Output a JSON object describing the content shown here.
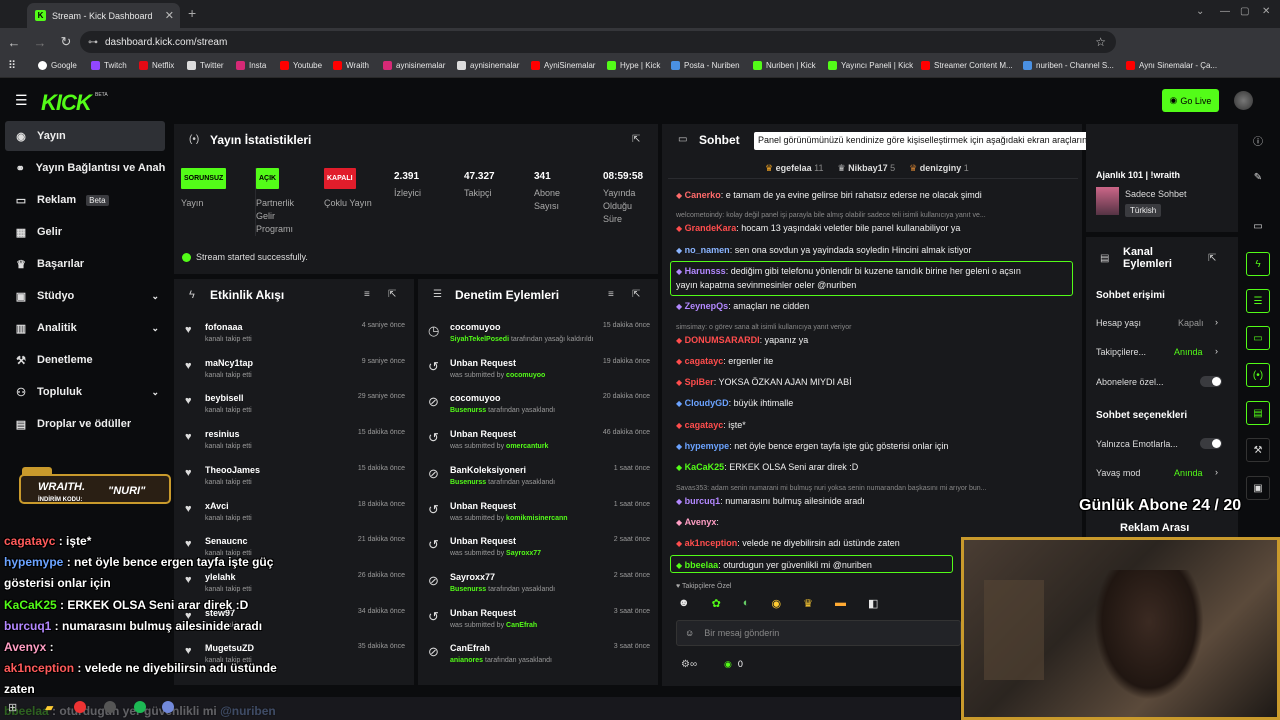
{
  "browser": {
    "tab_title": "Stream - Kick Dashboard",
    "url": "dashboard.kick.com/stream",
    "bookmarks": [
      "Google",
      "Twitch",
      "Netflix",
      "Twitter",
      "Insta",
      "Youtube",
      "Wraith",
      "aynisinemalar",
      "aynisinemalar",
      "AyniSinemalar",
      "Hype | Kick",
      "Posta - Nuriben",
      "Nuriben | Kick",
      "Yayıncı Paneli | Kick",
      "Streamer Content M...",
      "nuriben - Channel S...",
      "Aynı Sinemalar - Ça..."
    ]
  },
  "header": {
    "logo": "KICK",
    "logo_tag": "BETA",
    "go_live": "Go Live"
  },
  "sidebar": {
    "items": [
      {
        "label": "Yayın"
      },
      {
        "label": "Yayın Bağlantısı ve Anahtarı"
      },
      {
        "label": "Reklam",
        "tag": "Beta"
      },
      {
        "label": "Gelir"
      },
      {
        "label": "Başarılar"
      },
      {
        "label": "Stüdyo"
      },
      {
        "label": "Analitik"
      },
      {
        "label": "Denetleme"
      },
      {
        "label": "Topluluk"
      },
      {
        "label": "Droplar ve ödüller"
      }
    ]
  },
  "stats": {
    "title": "Yayın İstatistikleri",
    "items": [
      {
        "badge": "SORUNSUZ",
        "label": "Yayın"
      },
      {
        "badge": "AÇIK",
        "label": "Partnerlik Gelir Programı"
      },
      {
        "badge": "KAPALI",
        "label": "Çoklu Yayın"
      },
      {
        "value": "2.391",
        "label": "İzleyici"
      },
      {
        "value": "47.327",
        "label": "Takipçi"
      },
      {
        "value": "341",
        "label": "Abone Sayısı"
      },
      {
        "value": "08:59:58",
        "label": "Yayında Olduğu Süre"
      }
    ],
    "status": "Stream started successfully."
  },
  "activity": {
    "title": "Etkinlik Akışı",
    "rows": [
      {
        "name": "fofonaaa",
        "sub": "kanalı takip etti",
        "time": "4 saniye önce"
      },
      {
        "name": "maNcy1tap",
        "sub": "kanalı takip etti",
        "time": "9 saniye önce"
      },
      {
        "name": "beybisell",
        "sub": "kanalı takip etti",
        "time": "29 saniye önce"
      },
      {
        "name": "resinius",
        "sub": "kanalı takip etti",
        "time": "15 dakika önce"
      },
      {
        "name": "TheooJames",
        "sub": "kanalı takip etti",
        "time": "15 dakika önce"
      },
      {
        "name": "xAvci",
        "sub": "kanalı takip etti",
        "time": "18 dakika önce"
      },
      {
        "name": "Senaucnc",
        "sub": "kanalı takip etti",
        "time": "21 dakika önce"
      },
      {
        "name": "ylelahk",
        "sub": "kanalı takip etti",
        "time": "26 dakika önce"
      },
      {
        "name": "stew97",
        "sub": "kanalı takip etti",
        "time": "34 dakika önce"
      },
      {
        "name": "MugetsuZD",
        "sub": "kanalı takip etti",
        "time": "35 dakika önce"
      }
    ]
  },
  "moderation": {
    "title": "Denetim Eylemleri",
    "rows": [
      {
        "icon": "clock",
        "name": "cocomuyoo",
        "who": "SiyahTekelPosedi",
        "sub": "tarafından yasağı kaldırıldı",
        "time": "15 dakika önce"
      },
      {
        "icon": "undo",
        "name": "Unban Request",
        "sub": "was submitted by",
        "who": "cocomuyoo",
        "time": "19 dakika önce"
      },
      {
        "icon": "ban",
        "name": "cocomuyoo",
        "who": "Busenurss",
        "sub": "tarafından yasaklandı",
        "time": "20 dakika önce"
      },
      {
        "icon": "undo",
        "name": "Unban Request",
        "sub": "was submitted by",
        "who": "omercanturk",
        "time": "46 dakika önce"
      },
      {
        "icon": "ban",
        "name": "BanKoleksiyoneri",
        "who": "Busenurss",
        "sub": "tarafından yasaklandı",
        "time": "1 saat önce"
      },
      {
        "icon": "undo",
        "name": "Unban Request",
        "sub": "was submitted by",
        "who": "komikmisinercann",
        "time": "1 saat önce"
      },
      {
        "icon": "undo",
        "name": "Unban Request",
        "sub": "was submitted by",
        "who": "Sayroxx77",
        "time": "2 saat önce"
      },
      {
        "icon": "ban",
        "name": "Sayroxx77",
        "who": "Busenurss",
        "sub": "tarafından yasaklandı",
        "time": "2 saat önce"
      },
      {
        "icon": "undo",
        "name": "Unban Request",
        "sub": "was submitted by",
        "who": "CanEfrah",
        "time": "3 saat önce"
      },
      {
        "icon": "ban",
        "name": "CanEfrah",
        "who": "anianores",
        "sub": "tarafından yasaklandı",
        "time": "3 saat önce"
      }
    ]
  },
  "chat": {
    "title": "Sohbet",
    "tooltip": "Panel görünümünüzü kendinize göre kişiselleştirmek için aşağıdaki ekran araçlarına tıklayın veya sürükleyin",
    "top_gifters": [
      {
        "name": "egefelaa",
        "count": "11",
        "color": "#f5a623"
      },
      {
        "name": "Nikbay17",
        "count": "5",
        "color": "#cccccc"
      },
      {
        "name": "denizginy",
        "count": "1",
        "color": "#cd7f32"
      }
    ],
    "messages": [
      {
        "user": "Canerko",
        "color": "#ff6b6b",
        "text": ": e tamam de ya evine gelirse biri rahatsız ederse ne olacak şimdi"
      },
      {
        "system": "welcometoindy: kolay değil panel işi parayla bile almış olabilir sadece teli isimli kullanıcıya yanıt ve..."
      },
      {
        "user": "GrandeKara",
        "color": "#ff4d4d",
        "text": ": hocam 13 yaşındaki veletler bile panel kullanabiliyor ya"
      },
      {
        "user": "no_namen",
        "color": "#8ab4ff",
        "text": ": sen ona sovdun ya yayindada soyledin Hincini almak istiyor"
      },
      {
        "user": "Harunsss",
        "color": "#b388ff",
        "text": ": dediğim gibi telefonu yönlendir bi kuzene tanıdık birine her geleni o açsın",
        "text2": "yayın kapatma sevinmesinler oeler @nuriben",
        "highlight": true
      },
      {
        "user": "ZeynepQs",
        "color": "#b388ff",
        "text": ": amaçları ne cidden"
      },
      {
        "system": "simsimay: o görev sana alt isimli kullanıcıya yanıt veriyor"
      },
      {
        "user": "DONUMSARARDI",
        "color": "#ff4d4d",
        "text": ": yapanız ya"
      },
      {
        "user": "cagatayc",
        "color": "#ff4d4d",
        "text": ": ergenler ite"
      },
      {
        "user": "SpiBer",
        "color": "#ff4d4d",
        "text": ": YOKSA ÖZKAN AJAN MIYDI ABİ"
      },
      {
        "user": "CloudyGD",
        "color": "#6ba3ff",
        "text": ": büyük ihtimalle"
      },
      {
        "user": "cagatayc",
        "color": "#ff4d4d",
        "text": ": işte*"
      },
      {
        "user": "hypemype",
        "color": "#6ba3ff",
        "text": ": net öyle bence ergen tayfa işte güç gösterisi onlar için"
      },
      {
        "user": "KaCaK25",
        "color": "#53fc18",
        "text": ": ERKEK OLSA Seni arar direk :D"
      },
      {
        "system": "Savas353: adam senin numarani mi bulmuş nuri yoksa senin numarandan başkasını mi arıyor bun..."
      },
      {
        "user": "burcuq1",
        "color": "#b388ff",
        "text": ": numarasını bulmuş ailesinide aradı"
      },
      {
        "user": "Avenyx",
        "color": "#ff9ec4",
        "text": ":"
      },
      {
        "user": "ak1nception",
        "color": "#ff4d4d",
        "text": ": velede ne diyebilirsin adı üstünde zaten"
      },
      {
        "user": "bbeelaa",
        "color": "#53fc18",
        "text": ": oturdugun yer güvenlikli mi @nuriben",
        "highlight": true
      }
    ],
    "follower_only": "Takipçilere Özel",
    "input_placeholder": "Bir mesaj gönderin",
    "points": "0"
  },
  "right": {
    "stream_title": "Ajanlık 101 | !wraith",
    "channel_name": "Sadece Sohbet",
    "language": "Türkish",
    "actions_title": "Kanal Eylemleri",
    "chat_access": "Sohbet erişimi",
    "account_age": "Hesap yaşı",
    "account_age_value": "Kapalı",
    "followers": "Takipçilere...",
    "followers_value": "Anında",
    "subscribers": "Abonelere özel...",
    "chat_options": "Sohbet seçenekleri",
    "emotes_only": "Yalnızca Emotlarla...",
    "slow_mode": "Yavaş mod",
    "slow_mode_value": "Anında",
    "ad_break": "Reklam Arası"
  },
  "overlay": {
    "sub_goal": "Günlük Abone 24 / 20",
    "wraith_brand": "WRAITH.",
    "wraith_code_label": "İNDİRİM KODU:",
    "wraith_code": "\"NURI\"",
    "chat": [
      {
        "user": "cagatayc",
        "color": "#ff5b5b",
        "text": " : işte*"
      },
      {
        "user": "hypemype",
        "color": "#6ba3ff",
        "text": " : net öyle bence ergen tayfa işte güç"
      },
      {
        "text": "gösterisi onlar için"
      },
      {
        "user": "KaCaK25",
        "color": "#53fc18",
        "text": " : ERKEK OLSA Seni arar direk :D"
      },
      {
        "user": "burcuq1",
        "color": "#b388ff",
        "text": " : numarasını bulmuş ailesinide aradı"
      },
      {
        "user": "Avenyx",
        "color": "#ff9ec4",
        "text": " :"
      },
      {
        "user": "ak1nception",
        "color": "#ff5b5b",
        "text": " : velede ne diyebilirsin adı üstünde"
      },
      {
        "text": "zaten"
      },
      {
        "user": "bbeelaa",
        "color": "#53fc18",
        "text": " : oturdugun yer güvenlikli mi ",
        "mention": "@nuriben"
      }
    ]
  }
}
